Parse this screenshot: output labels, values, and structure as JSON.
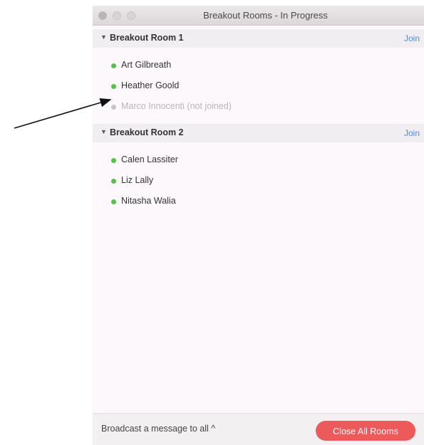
{
  "window": {
    "title": "Breakout Rooms - In Progress"
  },
  "rooms": [
    {
      "name": "Breakout Room 1",
      "join_label": "Join",
      "participants": [
        {
          "name": "Art Gilbreath",
          "status": "joined"
        },
        {
          "name": "Heather Goold",
          "status": "joined"
        },
        {
          "name": "Marco Innocenti (not joined)",
          "status": "not-joined"
        }
      ]
    },
    {
      "name": "Breakout Room 2",
      "join_label": "Join",
      "participants": [
        {
          "name": "Calen Lassiter",
          "status": "joined"
        },
        {
          "name": "Liz Lally",
          "status": "joined"
        },
        {
          "name": "Nitasha Walia",
          "status": "joined"
        }
      ]
    }
  ],
  "footer": {
    "broadcast_label": "Broadcast a message to all ^",
    "close_all_label": "Close All Rooms"
  },
  "colors": {
    "joined_dot": "#5bbf4e",
    "not_joined_dot": "#c8c4c6",
    "join_link": "#4a8fdc",
    "close_button": "#ed5a5c"
  },
  "icons": {
    "caret": "caret-down-icon",
    "annotation": "arrow-icon"
  }
}
